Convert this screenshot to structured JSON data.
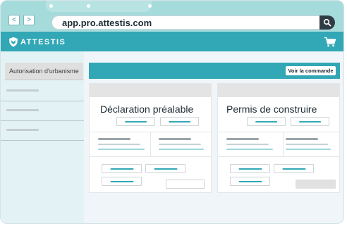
{
  "browser": {
    "url": "app.pro.attestis.com",
    "back_glyph": "<",
    "forward_glyph": ">"
  },
  "app": {
    "brand": "ATTESTIS"
  },
  "sidebar": {
    "active_item": "Autorisation d'urbanisme"
  },
  "toolbar": {
    "order_button": "Voir la commande"
  },
  "cards": [
    {
      "title": "Déclaration préalable"
    },
    {
      "title": "Permis de construire"
    }
  ],
  "colors": {
    "accent": "#32a7b6",
    "chrome": "#a6dbdb",
    "dark": "#2f3b45"
  }
}
